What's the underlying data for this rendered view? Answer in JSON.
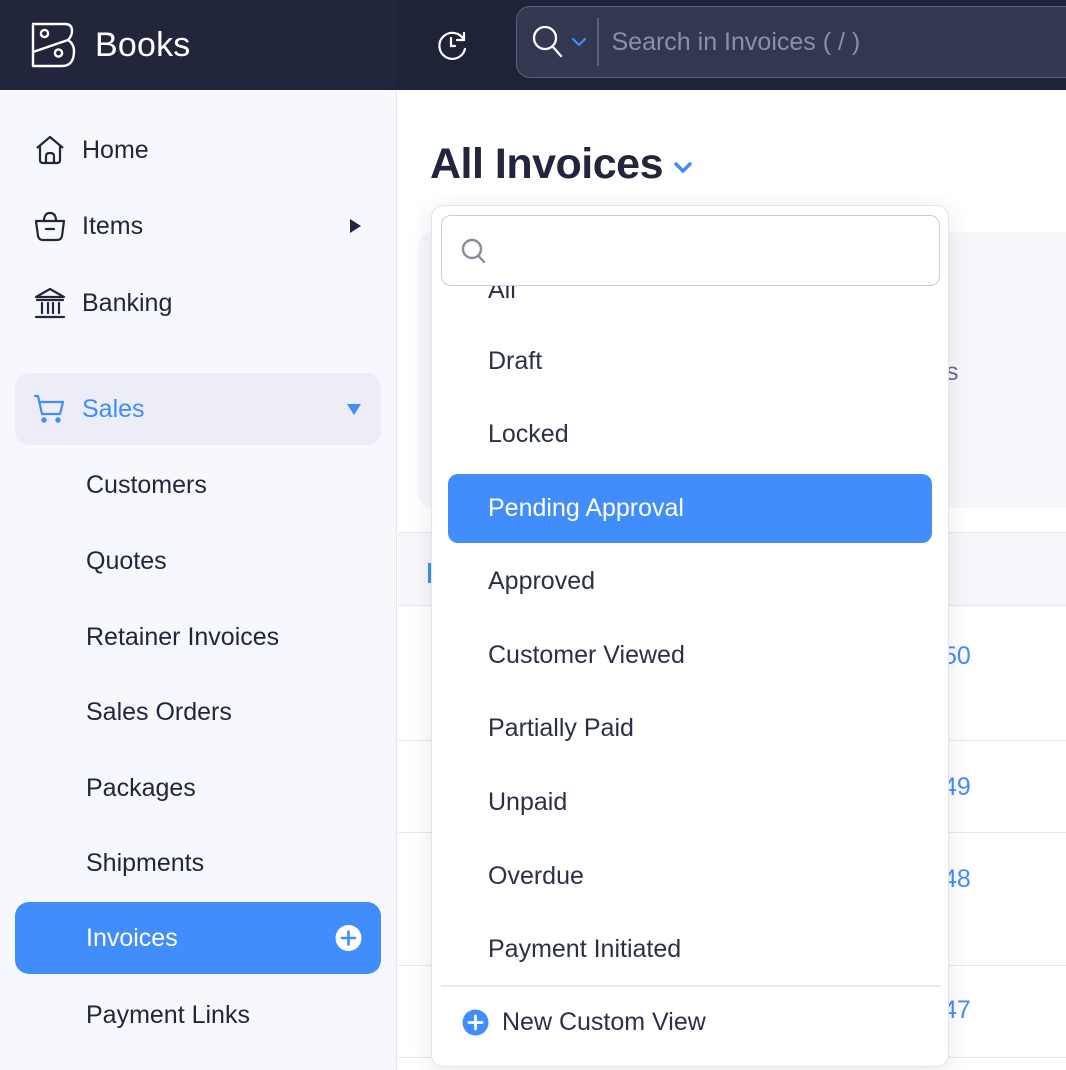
{
  "app": {
    "name": "Books",
    "logo_icon": "zoho-books-logo-icon"
  },
  "topbar": {
    "recent_icon": "recent-activity-icon",
    "search": {
      "scope_icon": "search-icon",
      "scope_caret_icon": "chevron-down-icon",
      "placeholder": "Search in Invoices ( / )",
      "value": ""
    }
  },
  "sidebar": {
    "items": [
      {
        "label": "Home",
        "icon": "home-icon"
      },
      {
        "label": "Items",
        "icon": "basket-icon",
        "has_submenu": true
      },
      {
        "label": "Banking",
        "icon": "bank-icon"
      },
      {
        "label": "Sales",
        "icon": "cart-icon",
        "expanded": true
      }
    ],
    "sales_sub_items": [
      {
        "label": "Customers"
      },
      {
        "label": "Quotes"
      },
      {
        "label": "Retainer Invoices"
      },
      {
        "label": "Sales Orders"
      },
      {
        "label": "Packages"
      },
      {
        "label": "Shipments"
      },
      {
        "label": "Invoices",
        "active": true,
        "action_icon": "plus-circle-icon"
      },
      {
        "label": "Payment Links"
      }
    ]
  },
  "main": {
    "title": "All Invoices",
    "background_partial": {
      "card_text_fragment": "s",
      "row_number_fragments": [
        "50",
        "49",
        "48",
        "47"
      ]
    }
  },
  "view_dropdown": {
    "search": {
      "placeholder": "",
      "value": ""
    },
    "options": [
      {
        "label": "All"
      },
      {
        "label": "Draft"
      },
      {
        "label": "Locked"
      },
      {
        "label": "Pending Approval",
        "selected": true
      },
      {
        "label": "Approved"
      },
      {
        "label": "Customer Viewed"
      },
      {
        "label": "Partially Paid"
      },
      {
        "label": "Unpaid"
      },
      {
        "label": "Overdue"
      },
      {
        "label": "Payment Initiated"
      }
    ],
    "footer_action": {
      "label": "New Custom View",
      "icon": "plus-circle-icon"
    }
  },
  "colors": {
    "accent": "#408dfb",
    "topbar_bg": "#1f2338",
    "brand_bg": "#22263d",
    "sidebar_bg": "#f7f8fd",
    "text_primary": "#21263c"
  }
}
